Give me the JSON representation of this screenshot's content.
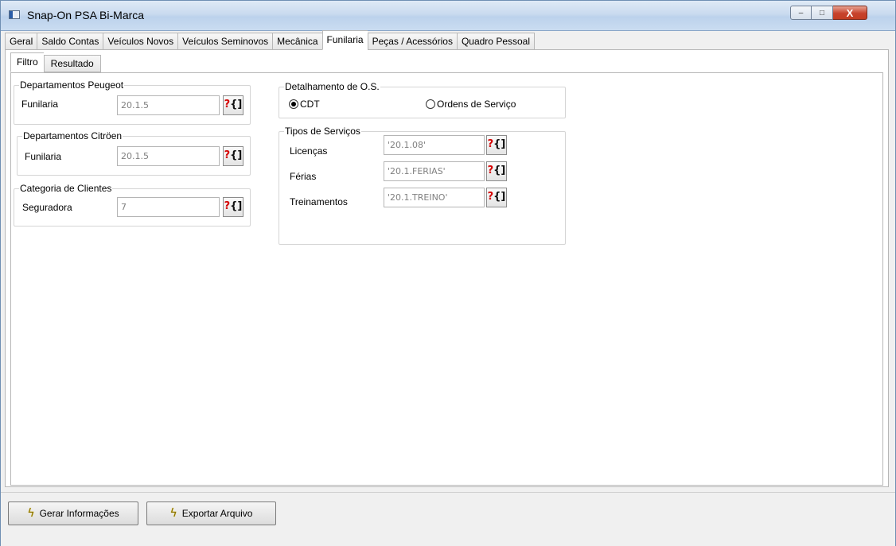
{
  "window": {
    "title": "Snap-On PSA Bi-Marca",
    "controls": {
      "minimize": "–",
      "maximize": "□",
      "close": "X"
    }
  },
  "main_tabs": [
    "Geral",
    "Saldo Contas",
    "Veículos Novos",
    "Veículos Seminovos",
    "Mecânica",
    "Funilaria",
    "Peças / Acessórios",
    "Quadro Pessoal"
  ],
  "main_tabs_active": "Funilaria",
  "sub_tabs": [
    "Filtro",
    "Resultado"
  ],
  "sub_tabs_active": "Filtro",
  "lookup_glyph": {
    "q": "?",
    "b": "{]"
  },
  "departamentos_peugeot": {
    "legend": "Departamentos Peugeot",
    "label": "Funilaria",
    "value": "20.1.5"
  },
  "departamentos_citroen": {
    "legend": "Departamentos Citröen",
    "label": "Funilaria",
    "value": "20.1.5"
  },
  "categoria_clientes": {
    "legend": "Categoria de Clientes",
    "label": "Seguradora",
    "value": "7"
  },
  "detalhamento": {
    "legend": "Detalhamento de O.S.",
    "options": [
      {
        "label": "CDT",
        "selected": true
      },
      {
        "label": "Ordens de Serviço",
        "selected": false
      }
    ]
  },
  "tipos_servicos": {
    "legend": "Tipos de Serviços",
    "rows": [
      {
        "label": "Licenças",
        "value": "'20.1.08'"
      },
      {
        "label": "Férias",
        "value": "'20.1.FERIAS'"
      },
      {
        "label": "Treinamentos",
        "value": "'20.1.TREINO'"
      }
    ]
  },
  "buttons": {
    "gerar": "Gerar Informações",
    "exportar": "Exportar Arquivo",
    "icon": "ϟ"
  },
  "colors": {
    "title_bar": "#c9daef",
    "close_button": "#c7422c",
    "lookup_question": "#d40000"
  }
}
